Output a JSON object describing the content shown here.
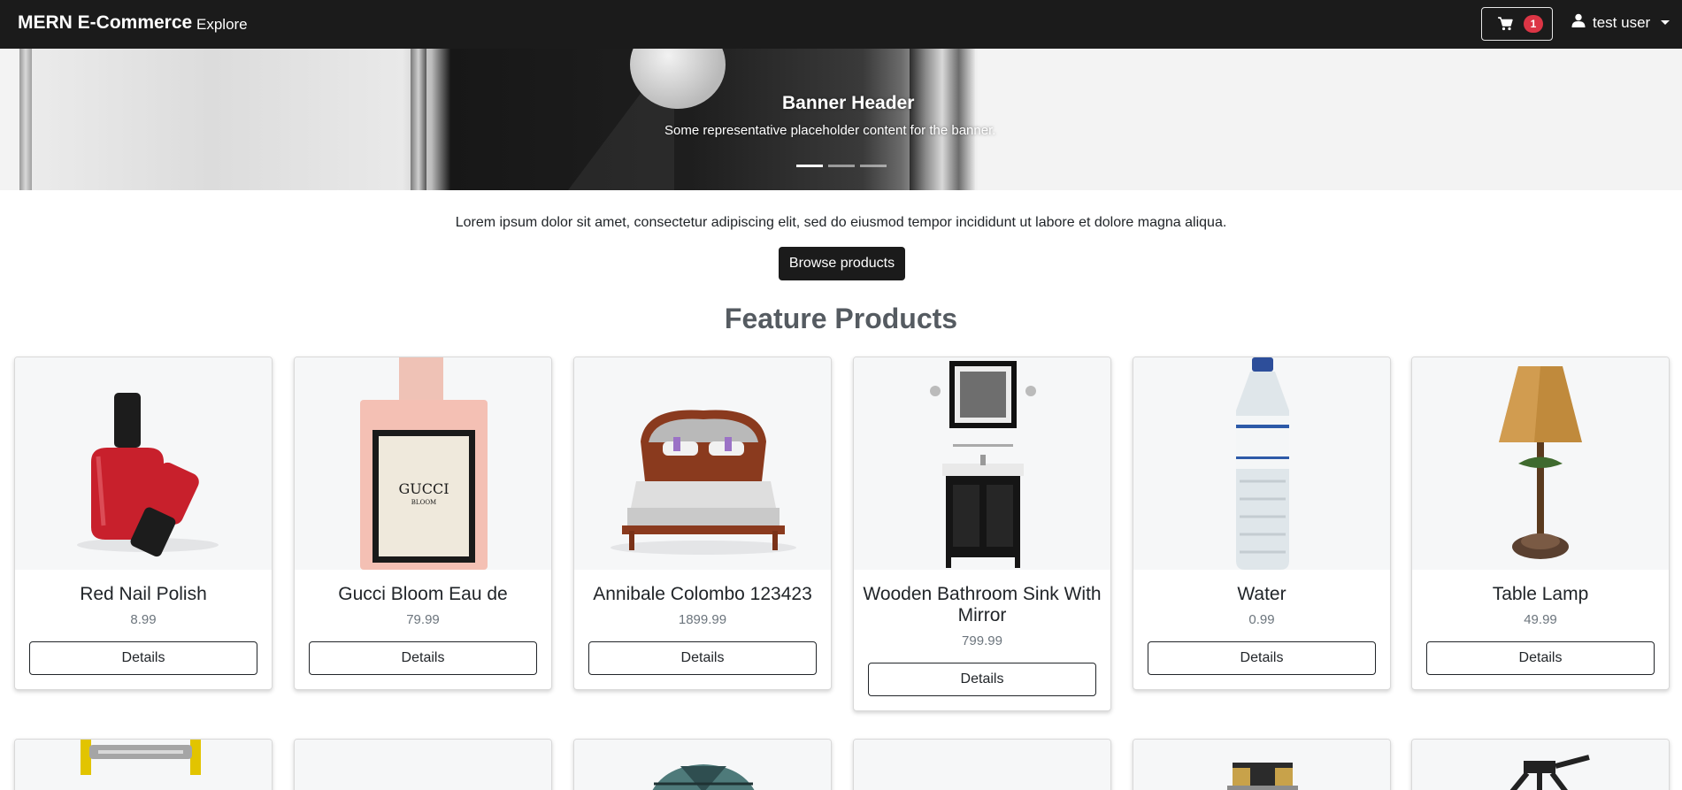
{
  "navbar": {
    "brand": "MERN E-Commerce",
    "explore": "Explore",
    "cart_count": "1",
    "user_name": "test user"
  },
  "banner": {
    "title": "Banner Header",
    "text": "Some representative placeholder content for the banner.",
    "slides": 3,
    "active_slide": 1
  },
  "intro": {
    "text": "Lorem ipsum dolor sit amet, consectetur adipiscing elit, sed do eiusmod tempor incididunt ut labore et dolore magna aliqua.",
    "browse_label": "Browse products"
  },
  "section_title": "Feature Products",
  "products": [
    {
      "name": "Red Nail Polish",
      "price": "8.99",
      "details_label": "Details"
    },
    {
      "name": "Gucci Bloom Eau de",
      "price": "79.99",
      "details_label": "Details"
    },
    {
      "name": "Annibale Colombo 123423",
      "price": "1899.99",
      "details_label": "Details"
    },
    {
      "name": "Wooden Bathroom Sink With Mirror",
      "price": "799.99",
      "details_label": "Details"
    },
    {
      "name": "Water",
      "price": "0.99",
      "details_label": "Details"
    },
    {
      "name": "Table Lamp",
      "price": "49.99",
      "details_label": "Details"
    }
  ],
  "colors": {
    "navbar_bg": "#1b1b1b",
    "badge": "#dc3545",
    "card_image_bg": "#f6f7f8",
    "heading": "#555b61"
  },
  "icons": {
    "cart": "cart-icon",
    "user": "user-icon",
    "caret": "chevron-down-icon"
  }
}
